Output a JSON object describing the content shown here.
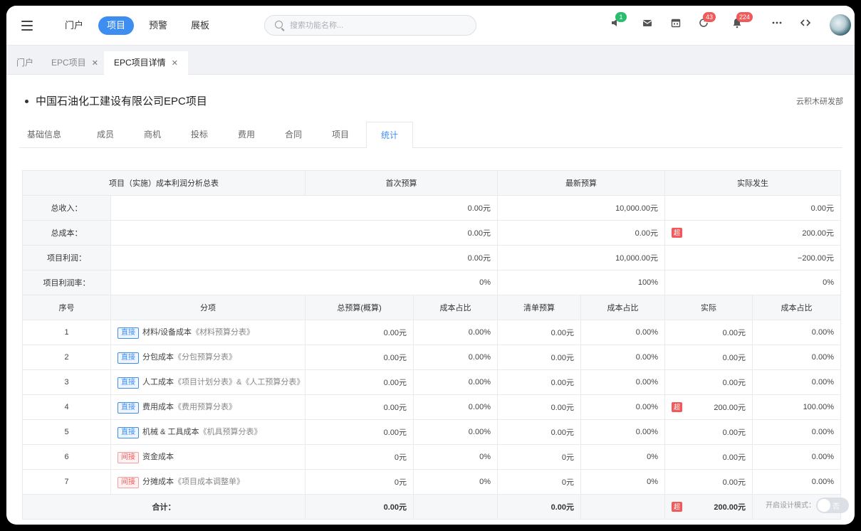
{
  "header": {
    "nav": [
      "门户",
      "项目",
      "预警",
      "展板"
    ],
    "search_placeholder": "搜索功能名称...",
    "icons": {
      "speaker_badge": "1",
      "refresh_badge": "43",
      "bell_badge": "224"
    }
  },
  "page_tabs": [
    {
      "label": "门户",
      "closable": false
    },
    {
      "label": "EPC项目",
      "closable": true
    },
    {
      "label": "EPC项目详情",
      "closable": true
    }
  ],
  "project": {
    "title": "中国石油化工建设有限公司EPC项目",
    "dept": "云积木研发部"
  },
  "sub_tabs": [
    "基础信息",
    "成员",
    "商机",
    "投标",
    "费用",
    "合同",
    "项目",
    "统计"
  ],
  "summary": {
    "header": [
      "项目（实施）成本利润分析总表",
      "首次预算",
      "最新预算",
      "实际发生"
    ],
    "rows": [
      {
        "label": "总收入：",
        "first": "0.00元",
        "latest": "10,000.00元",
        "actual": "0.00元",
        "over": false
      },
      {
        "label": "总成本：",
        "first": "0.00元",
        "latest": "0.00元",
        "actual": "200.00元",
        "over": true
      },
      {
        "label": "项目利润：",
        "first": "0.00元",
        "latest": "10,000.00元",
        "actual": "−200.00元",
        "over": false
      },
      {
        "label": "项目利润率：",
        "first": "0%",
        "latest": "100%",
        "actual": "0%",
        "over": false
      }
    ]
  },
  "detail": {
    "header": [
      "序号",
      "分项",
      "总预算(概算)",
      "成本占比",
      "清单预算",
      "成本占比",
      "实际",
      "成本占比"
    ],
    "over_label": "超",
    "rows": [
      {
        "no": "1",
        "tag": "直接",
        "tag_type": "blue",
        "name": "材料/设备成本",
        "ref": "《材料预算分表》",
        "budget": "0.00元",
        "ratio1": "0.00%",
        "list": "0.00元",
        "ratio2": "0.00%",
        "actual": "0.00元",
        "ratio3": "0.00%",
        "over": false
      },
      {
        "no": "2",
        "tag": "直接",
        "tag_type": "blue",
        "name": "分包成本",
        "ref": "《分包预算分表》",
        "budget": "0.00元",
        "ratio1": "0.00%",
        "list": "0.00元",
        "ratio2": "0.00%",
        "actual": "0.00元",
        "ratio3": "0.00%",
        "over": false
      },
      {
        "no": "3",
        "tag": "直接",
        "tag_type": "blue",
        "name": "人工成本",
        "ref": "《项目计划分表》&《人工预算分表》",
        "budget": "0.00元",
        "ratio1": "0.00%",
        "list": "0.00元",
        "ratio2": "0.00%",
        "actual": "0.00元",
        "ratio3": "0.00%",
        "over": false
      },
      {
        "no": "4",
        "tag": "直接",
        "tag_type": "blue",
        "name": "费用成本",
        "ref": "《费用预算分表》",
        "budget": "0.00元",
        "ratio1": "0.00%",
        "list": "0.00元",
        "ratio2": "0.00%",
        "actual": "200.00元",
        "ratio3": "100.00%",
        "over": true
      },
      {
        "no": "5",
        "tag": "直接",
        "tag_type": "blue",
        "name": "机械 & 工具成本",
        "ref": "《机具预算分表》",
        "budget": "0.00元",
        "ratio1": "0.00%",
        "list": "0.00元",
        "ratio2": "0.00%",
        "actual": "0.00元",
        "ratio3": "0.00%",
        "over": false
      },
      {
        "no": "6",
        "tag": "间接",
        "tag_type": "red",
        "name": "资金成本",
        "ref": "",
        "budget": "0元",
        "ratio1": "0%",
        "list": "0元",
        "ratio2": "0%",
        "actual": "0.00元",
        "ratio3": "0.00%",
        "over": false
      },
      {
        "no": "7",
        "tag": "间接",
        "tag_type": "red",
        "name": "分摊成本",
        "ref": "《项目成本调整单》",
        "budget": "0元",
        "ratio1": "0%",
        "list": "0元",
        "ratio2": "0%",
        "actual": "0.00元",
        "ratio3": "0.00%",
        "over": false
      }
    ],
    "total": {
      "label": "合计：",
      "budget": "0.00元",
      "list": "0.00元",
      "actual": "200.00元",
      "over": true
    }
  },
  "design_mode": {
    "label": "开启设计模式：",
    "state": "否"
  }
}
